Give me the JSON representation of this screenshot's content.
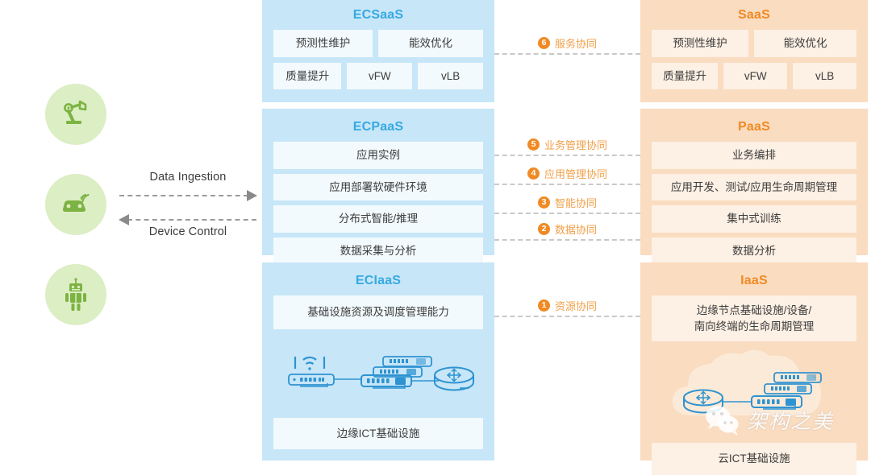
{
  "devices": [
    {
      "name": "robotic-arm",
      "icon": "robot-arm-icon"
    },
    {
      "name": "connected-car",
      "icon": "connected-car-icon"
    },
    {
      "name": "robot",
      "icon": "robot-icon"
    }
  ],
  "flows": {
    "ingestion_label": "Data Ingestion",
    "control_label": "Device Control"
  },
  "edge": {
    "saas": {
      "title": "ECSaaS",
      "row1": [
        "预测性维护",
        "能效优化"
      ],
      "row2": [
        "质量提升",
        "vFW",
        "vLB"
      ]
    },
    "paas": {
      "title": "ECPaaS",
      "items": [
        "应用实例",
        "应用部署软硬件环境",
        "分布式智能/推理",
        "数据采集与分析"
      ]
    },
    "iaas": {
      "title": "ECIaaS",
      "top_item": "基础设施资源及调度管理能力",
      "bottom_item": "边缘ICT基础设施"
    }
  },
  "cloud": {
    "saas": {
      "title": "SaaS",
      "row1": [
        "预测性维护",
        "能效优化"
      ],
      "row2": [
        "质量提升",
        "vFW",
        "vLB"
      ]
    },
    "paas": {
      "title": "PaaS",
      "items": [
        "业务编排",
        "应用开发、测试/应用生命周期管理",
        "集中式训练",
        "数据分析"
      ]
    },
    "iaas": {
      "title": "IaaS",
      "top_item": "边缘节点基础设施/设备/\n南向终端的生命周期管理",
      "bottom_item": "云ICT基础设施"
    }
  },
  "collaboration": [
    {
      "num": "6",
      "label": "服务协同"
    },
    {
      "num": "5",
      "label": "业务管理协同"
    },
    {
      "num": "4",
      "label": "应用管理协同"
    },
    {
      "num": "3",
      "label": "智能协同"
    },
    {
      "num": "2",
      "label": "数据协同"
    },
    {
      "num": "1",
      "label": "资源协同"
    }
  ],
  "watermark": {
    "text": "架构之美"
  },
  "colors": {
    "edge_panel": "#c7e6f8",
    "edge_cell": "#f2fafd",
    "edge_title": "#36a9e1",
    "cloud_panel": "#fadcc0",
    "cloud_cell": "#fdf0e4",
    "cloud_title": "#f08a24",
    "device_circle": "#dceec4",
    "device_glyph": "#7cb342",
    "collab_accent": "#f08a24",
    "dash_line": "#c9c9c9",
    "network_icon": "#2f93d1"
  }
}
